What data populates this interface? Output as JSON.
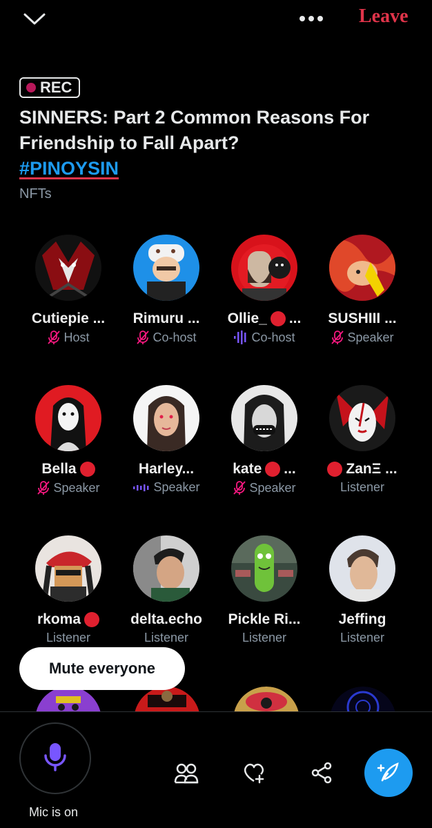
{
  "header": {
    "leave_label": "Leave"
  },
  "space": {
    "rec_label": "REC",
    "title": "SINNERS: Part 2 Common Reasons For Friendship to Fall Apart?",
    "hashtag": "#PINOYSIN",
    "topic": "NFTs"
  },
  "participants": [
    {
      "name": "Cutiepie ...",
      "role": "Host",
      "role_icon": "mic-muted-icon",
      "red_dot": "none"
    },
    {
      "name": "Rimuru ...",
      "role": "Co-host",
      "role_icon": "mic-muted-icon",
      "red_dot": "none"
    },
    {
      "name": "Ollie_",
      "name_suffix": "...",
      "role": "Co-host",
      "role_icon": "speaking-bars-icon",
      "red_dot": "middle"
    },
    {
      "name": "SUSHIII ...",
      "role": "Speaker",
      "role_icon": "mic-muted-icon",
      "red_dot": "none"
    },
    {
      "name": "Bella",
      "role": "Speaker",
      "role_icon": "mic-muted-icon",
      "red_dot": "after"
    },
    {
      "name": "Harley...",
      "role": "Speaker",
      "role_icon": "speaking-wave-icon",
      "red_dot": "none"
    },
    {
      "name": "kate",
      "name_suffix": "...",
      "role": "Speaker",
      "role_icon": "mic-muted-icon",
      "red_dot": "middle"
    },
    {
      "name": "ZanΞ ...",
      "role": "Listener",
      "role_icon": "none",
      "red_dot": "before"
    },
    {
      "name": "rkoma",
      "role": "Listener",
      "role_icon": "none",
      "red_dot": "after"
    },
    {
      "name": "delta.echo",
      "role": "Listener",
      "role_icon": "none",
      "red_dot": "none"
    },
    {
      "name": "Pickle Ri...",
      "role": "Listener",
      "role_icon": "none",
      "red_dot": "none"
    },
    {
      "name": "Jeffing",
      "role": "Listener",
      "role_icon": "none",
      "red_dot": "none"
    }
  ],
  "mute_everyone_label": "Mute everyone",
  "bottom_bar": {
    "mic_status": "Mic is on",
    "icons": [
      "people-icon",
      "heart-plus-icon",
      "share-icon",
      "compose-feather-icon"
    ]
  },
  "colors": {
    "accent_blue": "#1d9bf0",
    "leave_red": "#e0344a",
    "muted_pink": "#f91880",
    "speaking_purple": "#7856ff",
    "rec_dot": "#b8185a"
  }
}
